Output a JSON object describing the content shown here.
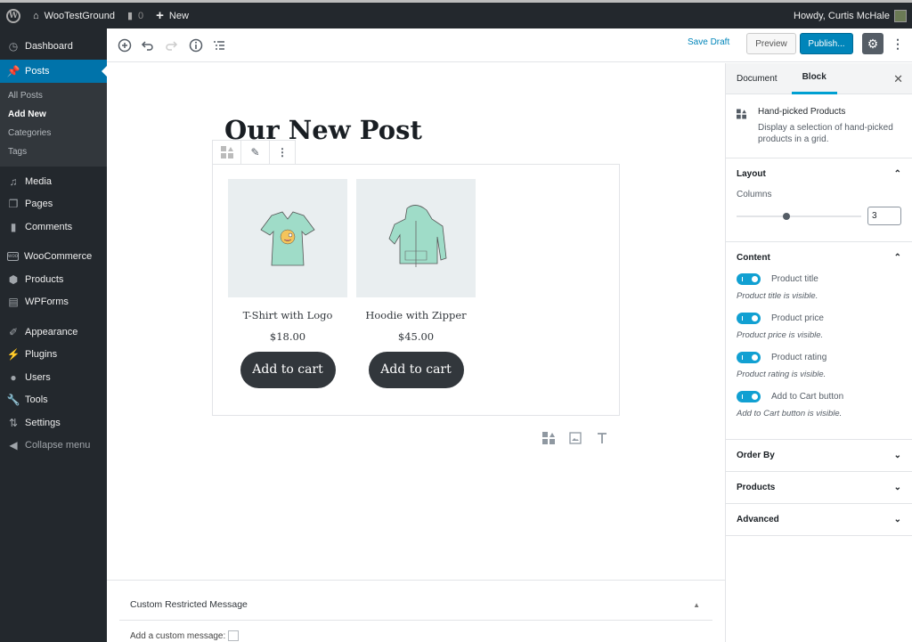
{
  "adminbar": {
    "site_name": "WooTestGround",
    "comments_count": "0",
    "new_label": "New",
    "greeting": "Howdy, Curtis McHale"
  },
  "sidebar": {
    "items": [
      {
        "label": "Dashboard",
        "icon": "dashboard-icon"
      },
      {
        "label": "Posts",
        "icon": "pin-icon",
        "active": true
      },
      {
        "label": "Media",
        "icon": "media-icon"
      },
      {
        "label": "Pages",
        "icon": "pages-icon"
      },
      {
        "label": "Comments",
        "icon": "comment-icon"
      },
      {
        "label": "WooCommerce",
        "icon": "woo-icon"
      },
      {
        "label": "Products",
        "icon": "box-icon"
      },
      {
        "label": "WPForms",
        "icon": "form-icon"
      },
      {
        "label": "Appearance",
        "icon": "brush-icon"
      },
      {
        "label": "Plugins",
        "icon": "plug-icon"
      },
      {
        "label": "Users",
        "icon": "user-icon"
      },
      {
        "label": "Tools",
        "icon": "wrench-icon"
      },
      {
        "label": "Settings",
        "icon": "settings-icon"
      },
      {
        "label": "Collapse menu",
        "icon": "collapse-icon"
      }
    ],
    "submenu": [
      "All Posts",
      "Add New",
      "Categories",
      "Tags"
    ]
  },
  "toolbar": {
    "save_draft": "Save Draft",
    "preview": "Preview",
    "publish": "Publish..."
  },
  "editor": {
    "post_title": "Our New Post",
    "products": [
      {
        "name": "T-Shirt with Logo",
        "price": "$18.00",
        "button": "Add to cart"
      },
      {
        "name": "Hoodie with Zipper",
        "price": "$45.00",
        "button": "Add to cart"
      }
    ]
  },
  "metabox": {
    "title": "Custom Restricted Message",
    "field_label": "Add a custom message:"
  },
  "inspector": {
    "tabs": [
      "Document",
      "Block"
    ],
    "active_tab": "Block",
    "block_title": "Hand-picked Products",
    "block_desc": "Display a selection of hand-picked products in a grid.",
    "layout": {
      "title": "Layout",
      "columns_label": "Columns",
      "columns_value": "3",
      "columns_min": 1,
      "columns_max": 6
    },
    "content": {
      "title": "Content",
      "toggles": [
        {
          "label": "Product title",
          "help": "Product title is visible.",
          "on": true
        },
        {
          "label": "Product price",
          "help": "Product price is visible.",
          "on": true
        },
        {
          "label": "Product rating",
          "help": "Product rating is visible.",
          "on": true
        },
        {
          "label": "Add to Cart button",
          "help": "Add to Cart button is visible.",
          "on": true
        }
      ]
    },
    "collapsed_panels": [
      "Order By",
      "Products",
      "Advanced"
    ]
  },
  "colors": {
    "accent": "#0085ba",
    "toggle_on": "#11a0d2",
    "adminbar": "#23282d",
    "menu_active": "#0073aa"
  }
}
